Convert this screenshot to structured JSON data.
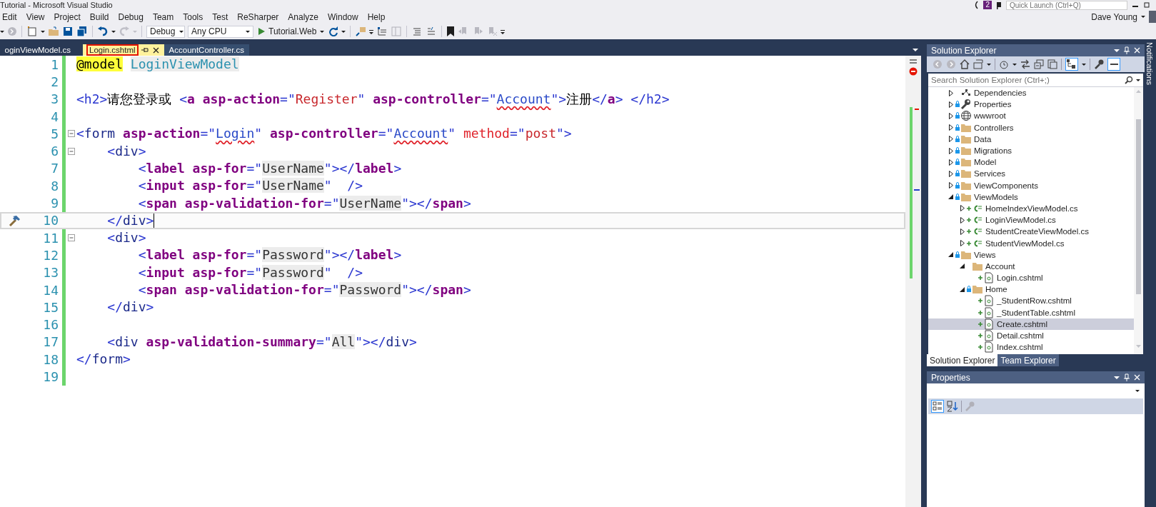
{
  "window": {
    "title": "Tutorial - Microsoft Visual Studio",
    "notification_count": "2",
    "quick_launch": {
      "placeholder": "Quick Launch (Ctrl+Q)"
    },
    "user": "Dave Young"
  },
  "menu": [
    "Edit",
    "View",
    "Project",
    "Build",
    "Debug",
    "Team",
    "Tools",
    "Test",
    "ReSharper",
    "Analyze",
    "Window",
    "Help"
  ],
  "toolbar": {
    "configuration": "Debug",
    "platform": "Any CPU",
    "start_target": "Tutorial.Web"
  },
  "document_tabs": [
    {
      "label": "oginViewModel.cs",
      "selected": false,
      "annotated": false
    },
    {
      "label": "Login.cshtml",
      "selected": true,
      "annotated": true
    },
    {
      "label": "AccountController.cs",
      "selected": false,
      "annotated": false
    }
  ],
  "editor": {
    "lines": [
      {
        "number": "1",
        "foldable": false,
        "current": false,
        "tokens": [
          {
            "text": "@model",
            "kind": "razor"
          },
          {
            "text": "LoginViewModel",
            "kind": "model"
          }
        ]
      },
      {
        "number": "2",
        "foldable": false,
        "current": false
      },
      {
        "number": "3",
        "foldable": false,
        "current": false,
        "tokens": [
          {
            "text": "<h2>",
            "kind": "punct"
          },
          {
            "text": "请您登录或 ",
            "kind": "text"
          },
          {
            "text": "<",
            "kind": "punct"
          },
          {
            "text": "a asp-action",
            "kind": "taghelper"
          },
          {
            "text": "=\"",
            "kind": "punct"
          },
          {
            "text": "Register",
            "kind": "string"
          },
          {
            "text": "\" ",
            "kind": "punct"
          },
          {
            "text": "asp-controller",
            "kind": "taghelper"
          },
          {
            "text": "=\"",
            "kind": "punct"
          },
          {
            "text": "Account",
            "kind": "link"
          },
          {
            "text": "\">",
            "kind": "punct"
          },
          {
            "text": "注册",
            "kind": "text"
          },
          {
            "text": "</",
            "kind": "punct"
          },
          {
            "text": "a",
            "kind": "taghelper"
          },
          {
            "text": "> </h2>",
            "kind": "punct"
          }
        ]
      },
      {
        "number": "4",
        "foldable": false,
        "current": false
      },
      {
        "number": "5",
        "foldable": true,
        "current": false,
        "tokens": [
          {
            "text": "<",
            "kind": "punct"
          },
          {
            "text": "form",
            "kind": "element"
          },
          {
            "text": " asp-action",
            "kind": "taghelper"
          },
          {
            "text": "=\"",
            "kind": "punct"
          },
          {
            "text": "Login",
            "kind": "link"
          },
          {
            "text": "\" ",
            "kind": "punct"
          },
          {
            "text": "asp-controller",
            "kind": "taghelper"
          },
          {
            "text": "=\"",
            "kind": "punct"
          },
          {
            "text": "Account",
            "kind": "link"
          },
          {
            "text": "\" ",
            "kind": "punct"
          },
          {
            "text": "method",
            "kind": "attr"
          },
          {
            "text": "=\"",
            "kind": "punct"
          },
          {
            "text": "post",
            "kind": "string"
          },
          {
            "text": "\">",
            "kind": "punct"
          }
        ]
      },
      {
        "number": "6",
        "foldable": true,
        "current": false,
        "tokens": [
          {
            "text": "    <",
            "kind": "punct"
          },
          {
            "text": "div",
            "kind": "element"
          },
          {
            "text": ">",
            "kind": "punct"
          }
        ]
      },
      {
        "number": "7",
        "foldable": false,
        "current": false,
        "tokens": [
          {
            "text": "        <",
            "kind": "punct"
          },
          {
            "text": "label asp-for",
            "kind": "taghelper"
          },
          {
            "text": "=\"",
            "kind": "punct"
          },
          {
            "text": "UserName",
            "kind": "ref"
          },
          {
            "text": "\"></",
            "kind": "punct"
          },
          {
            "text": "label",
            "kind": "taghelper"
          },
          {
            "text": ">",
            "kind": "punct"
          }
        ]
      },
      {
        "number": "8",
        "foldable": false,
        "current": false,
        "tokens": [
          {
            "text": "        <",
            "kind": "punct"
          },
          {
            "text": "input asp-for",
            "kind": "taghelper"
          },
          {
            "text": "=\"",
            "kind": "punct"
          },
          {
            "text": "UserName",
            "kind": "ref"
          },
          {
            "text": "\"  />",
            "kind": "punct"
          }
        ]
      },
      {
        "number": "9",
        "foldable": false,
        "current": false,
        "tokens": [
          {
            "text": "        <",
            "kind": "punct"
          },
          {
            "text": "span asp-validation-for",
            "kind": "taghelper"
          },
          {
            "text": "=\"",
            "kind": "punct"
          },
          {
            "text": "UserName",
            "kind": "ref"
          },
          {
            "text": "\"></",
            "kind": "punct"
          },
          {
            "text": "span",
            "kind": "taghelper"
          },
          {
            "text": ">",
            "kind": "punct"
          }
        ]
      },
      {
        "number": "10",
        "foldable": false,
        "current": true,
        "tokens": [
          {
            "text": "    </",
            "kind": "punct"
          },
          {
            "text": "div",
            "kind": "element"
          },
          {
            "text": ">",
            "kind": "punct"
          }
        ]
      },
      {
        "number": "11",
        "foldable": true,
        "current": false,
        "tokens": [
          {
            "text": "    <",
            "kind": "punct"
          },
          {
            "text": "div",
            "kind": "element"
          },
          {
            "text": ">",
            "kind": "punct"
          }
        ]
      },
      {
        "number": "12",
        "foldable": false,
        "current": false,
        "tokens": [
          {
            "text": "        <",
            "kind": "punct"
          },
          {
            "text": "label asp-for",
            "kind": "taghelper"
          },
          {
            "text": "=\"",
            "kind": "punct"
          },
          {
            "text": "Password",
            "kind": "ref"
          },
          {
            "text": "\"></",
            "kind": "punct"
          },
          {
            "text": "label",
            "kind": "taghelper"
          },
          {
            "text": ">",
            "kind": "punct"
          }
        ]
      },
      {
        "number": "13",
        "foldable": false,
        "current": false,
        "tokens": [
          {
            "text": "        <",
            "kind": "punct"
          },
          {
            "text": "input asp-for",
            "kind": "taghelper"
          },
          {
            "text": "=\"",
            "kind": "punct"
          },
          {
            "text": "Password",
            "kind": "ref"
          },
          {
            "text": "\"  />",
            "kind": "punct"
          }
        ]
      },
      {
        "number": "14",
        "foldable": false,
        "current": false,
        "tokens": [
          {
            "text": "        <",
            "kind": "punct"
          },
          {
            "text": "span asp-validation-for",
            "kind": "taghelper"
          },
          {
            "text": "=\"",
            "kind": "punct"
          },
          {
            "text": "Password",
            "kind": "ref"
          },
          {
            "text": "\"></",
            "kind": "punct"
          },
          {
            "text": "span",
            "kind": "taghelper"
          },
          {
            "text": ">",
            "kind": "punct"
          }
        ]
      },
      {
        "number": "15",
        "foldable": false,
        "current": false,
        "tokens": [
          {
            "text": "    </",
            "kind": "punct"
          },
          {
            "text": "div",
            "kind": "element"
          },
          {
            "text": ">",
            "kind": "punct"
          }
        ]
      },
      {
        "number": "16",
        "foldable": false,
        "current": false
      },
      {
        "number": "17",
        "foldable": false,
        "current": false,
        "tokens": [
          {
            "text": "    <",
            "kind": "punct"
          },
          {
            "text": "div",
            "kind": "element"
          },
          {
            "text": " asp-validation-summary",
            "kind": "taghelper"
          },
          {
            "text": "=\"",
            "kind": "punct"
          },
          {
            "text": "All",
            "kind": "ref"
          },
          {
            "text": "\"></",
            "kind": "punct"
          },
          {
            "text": "div",
            "kind": "element"
          },
          {
            "text": ">",
            "kind": "punct"
          }
        ]
      },
      {
        "number": "18",
        "foldable": false,
        "current": false,
        "tokens": [
          {
            "text": "</",
            "kind": "punct"
          },
          {
            "text": "form",
            "kind": "element"
          },
          {
            "text": ">",
            "kind": "punct"
          }
        ]
      },
      {
        "number": "19",
        "foldable": false,
        "current": false
      }
    ]
  },
  "solution_explorer": {
    "title": "Solution Explorer",
    "search": {
      "placeholder": "Search Solution Explorer (Ctrl+;)"
    },
    "tree": [
      {
        "label": "Dependencies",
        "kind": "dependencies",
        "locked": false,
        "added": false,
        "expanded": false,
        "selected": false
      },
      {
        "label": "Properties",
        "kind": "wrench",
        "locked": true,
        "added": false,
        "expanded": false,
        "selected": false
      },
      {
        "label": "wwwroot",
        "kind": "globe",
        "locked": true,
        "added": false,
        "expanded": false,
        "selected": false
      },
      {
        "label": "Controllers",
        "kind": "folder",
        "locked": true,
        "added": false,
        "expanded": false,
        "selected": false
      },
      {
        "label": "Data",
        "kind": "folder",
        "locked": true,
        "added": false,
        "expanded": false,
        "selected": false
      },
      {
        "label": "Migrations",
        "kind": "folder",
        "locked": true,
        "added": false,
        "expanded": false,
        "selected": false
      },
      {
        "label": "Model",
        "kind": "folder",
        "locked": true,
        "added": false,
        "expanded": false,
        "selected": false
      },
      {
        "label": "Services",
        "kind": "folder",
        "locked": true,
        "added": false,
        "expanded": false,
        "selected": false
      },
      {
        "label": "ViewComponents",
        "kind": "folder",
        "locked": true,
        "added": false,
        "expanded": false,
        "selected": false
      },
      {
        "label": "ViewModels",
        "kind": "folder",
        "locked": true,
        "added": false,
        "expanded": true,
        "selected": false,
        "children": [
          {
            "label": "HomeIndexViewModel.cs",
            "kind": "csharp",
            "locked": false,
            "added": true,
            "expanded": false,
            "selected": false
          },
          {
            "label": "LoginViewModel.cs",
            "kind": "csharp",
            "locked": false,
            "added": true,
            "expanded": false,
            "selected": false
          },
          {
            "label": "StudentCreateViewModel.cs",
            "kind": "csharp",
            "locked": false,
            "added": true,
            "expanded": false,
            "selected": false
          },
          {
            "label": "StudentViewModel.cs",
            "kind": "csharp",
            "locked": false,
            "added": true,
            "expanded": false,
            "selected": false
          }
        ]
      },
      {
        "label": "Views",
        "kind": "folder",
        "locked": true,
        "added": false,
        "expanded": true,
        "selected": false,
        "children": [
          {
            "label": "Account",
            "kind": "folder",
            "locked": false,
            "added": false,
            "expanded": true,
            "selected": false,
            "children": [
              {
                "label": "Login.cshtml",
                "kind": "razor-file",
                "locked": false,
                "added": true,
                "selected": false
              }
            ]
          },
          {
            "label": "Home",
            "kind": "folder",
            "locked": true,
            "added": false,
            "expanded": true,
            "selected": false,
            "children": [
              {
                "label": "_StudentRow.cshtml",
                "kind": "razor-file",
                "locked": false,
                "added": true,
                "selected": false
              },
              {
                "label": "_StudentTable.cshtml",
                "kind": "razor-file",
                "locked": false,
                "added": true,
                "selected": false
              },
              {
                "label": "Create.cshtml",
                "kind": "razor-file",
                "locked": false,
                "added": true,
                "selected": true
              },
              {
                "label": "Detail.cshtml",
                "kind": "razor-file",
                "locked": false,
                "added": true,
                "selected": false
              },
              {
                "label": "Index.cshtml",
                "kind": "razor-file",
                "locked": false,
                "added": true,
                "selected": false
              }
            ]
          }
        ]
      }
    ],
    "tabs": [
      {
        "label": "Solution Explorer",
        "selected": true
      },
      {
        "label": "Team Explorer",
        "selected": false
      }
    ]
  },
  "properties": {
    "title": "Properties"
  },
  "notifications_label": "Notifications"
}
